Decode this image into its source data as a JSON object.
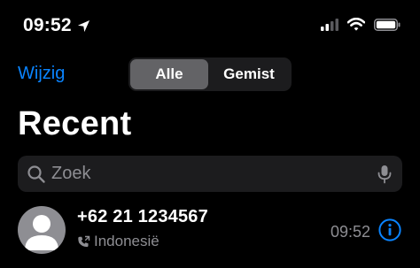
{
  "status_bar": {
    "time": "09:52",
    "icons": [
      "location-arrow-icon",
      "cellular-signal-icon",
      "wifi-icon",
      "battery-icon"
    ]
  },
  "nav": {
    "edit_label": "Wijzig",
    "segments": [
      {
        "label": "Alle",
        "selected": true
      },
      {
        "label": "Gemist",
        "selected": false
      }
    ]
  },
  "title": "Recent",
  "search": {
    "placeholder": "Zoek",
    "icons": [
      "search-icon",
      "microphone-icon"
    ]
  },
  "calls": [
    {
      "name": "+62 21 1234567",
      "type_icon": "phone-outgoing-icon",
      "location": "Indonesië",
      "time": "09:52"
    }
  ],
  "colors": {
    "background": "#000000",
    "accent": "#0a84ff",
    "secondary_text": "#8e8e93",
    "field_background": "#1c1c1e",
    "selected_segment": "#636366"
  }
}
